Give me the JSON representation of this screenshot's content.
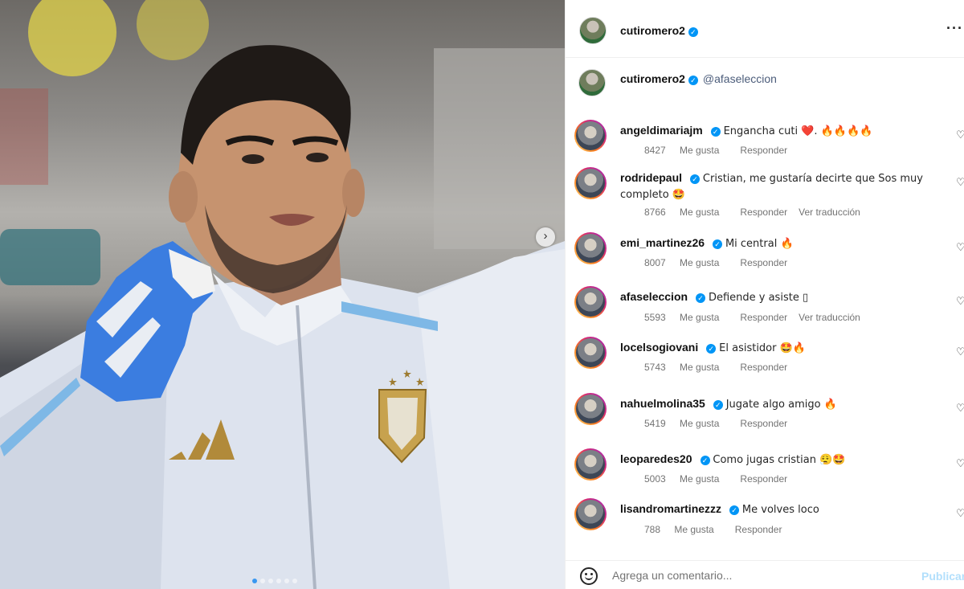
{
  "post": {
    "username": "cutiromero2",
    "caption_username": "cutiromero2",
    "caption_mention": "@afaseleccion",
    "more_icon": "more-horizontal-icon",
    "carousel": {
      "next_icon": "chevron-right-icon",
      "slide_count": 6,
      "active_index": 0
    }
  },
  "labels": {
    "likes_suffix": "Me gusta",
    "reply": "Responder",
    "translate": "Ver traducción",
    "comment_placeholder": "Agrega un comentario...",
    "post_button": "Publicar"
  },
  "comments": [
    {
      "user": "angeldimariajm",
      "text": "Engancha cuti ❤️. 🔥🔥🔥🔥",
      "likes": "8427",
      "translate": false
    },
    {
      "user": "rodridepaul",
      "text": "Cristian, me gustaría decirte que Sos muy completo 🤩",
      "likes": "8766",
      "translate": true
    },
    {
      "user": "emi_martinez26",
      "text": "Mi central 🔥",
      "likes": "8007",
      "translate": false
    },
    {
      "user": "afaseleccion",
      "text": "Defiende y asiste ▯",
      "likes": "5593",
      "translate": true
    },
    {
      "user": "locelsogiovani",
      "text": "El asistidor 🤩🔥",
      "likes": "5743",
      "translate": false
    },
    {
      "user": "nahuelmolina35",
      "text": "Jugate algo amigo 🔥",
      "likes": "5419",
      "translate": false
    },
    {
      "user": "leoparedes20",
      "text": "Como jugas cristian 😮‍💨🤩",
      "likes": "5003",
      "translate": false
    },
    {
      "user": "lisandromartinezzz",
      "text": "Me volves loco",
      "likes": "788",
      "translate": false
    }
  ],
  "colors": {
    "verified": "#0095f6",
    "post_button_disabled": "#b2dffc",
    "meta_text": "#737373"
  }
}
